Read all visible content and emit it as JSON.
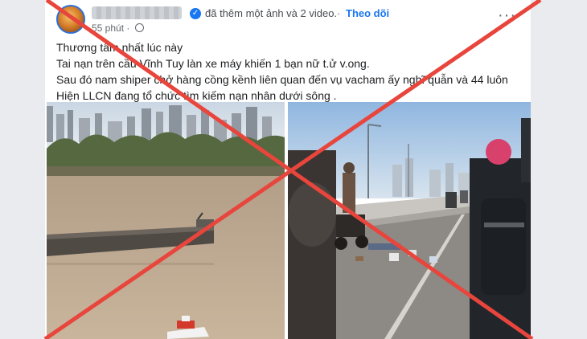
{
  "post": {
    "author_action": "đã thêm một ảnh và 2 video.",
    "separator": "·",
    "follow_label": "Theo dõi",
    "timestamp": "55 phút",
    "meta_separator": "·",
    "more_label": "···",
    "verified_glyph": "✓",
    "text_lines": [
      "Thương tâm nhất lúc này",
      "Tai nạn trên cầu Vĩnh Tuy làn xe máy khiến 1 bạn nữ t.ử v.ong.",
      "Sau đó nam shiper chở hàng cồng kềnh liên quan đến vụ vacham ấy nghĩ quẫn và 44 luôn",
      "Hiện LLCN đang tổ chức tìm kiếm nạn nhân dưới sông ."
    ]
  },
  "overlay": {
    "color": "#e8453c"
  },
  "icons": [
    "avatar",
    "verified-badge-icon",
    "globe-icon",
    "more-options-icon"
  ]
}
